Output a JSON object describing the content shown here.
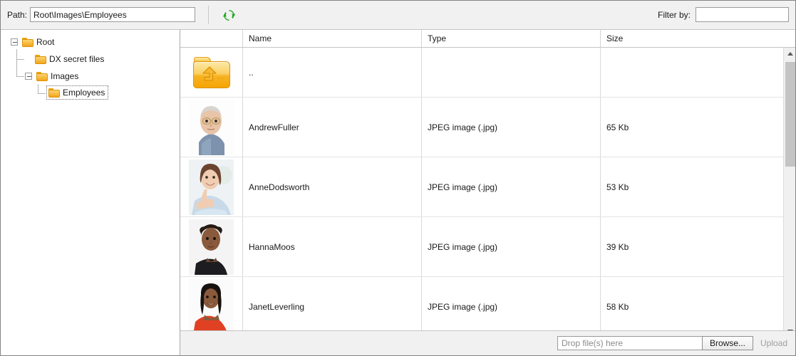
{
  "toolbar": {
    "path_label": "Path:",
    "path_value": "Root\\Images\\Employees",
    "refresh_icon": "refresh-icon",
    "filter_label": "Filter by:",
    "filter_value": "",
    "filter_placeholder": ""
  },
  "tree": {
    "nodes": [
      {
        "label": "Root",
        "icon": "folder-icon",
        "depth": 0,
        "expanded": true,
        "selected": false
      },
      {
        "label": "DX secret files",
        "icon": "folder-icon",
        "depth": 1,
        "expanded": null,
        "selected": false
      },
      {
        "label": "Images",
        "icon": "folder-icon",
        "depth": 1,
        "expanded": true,
        "selected": false
      },
      {
        "label": "Employees",
        "icon": "folder-icon",
        "depth": 2,
        "expanded": null,
        "selected": true
      }
    ]
  },
  "grid": {
    "columns": [
      {
        "key": "thumb",
        "label": ""
      },
      {
        "key": "name",
        "label": "Name"
      },
      {
        "key": "type",
        "label": "Type"
      },
      {
        "key": "size",
        "label": "Size"
      }
    ],
    "rows": [
      {
        "name": "..",
        "type": "",
        "size": "",
        "icon": "up-folder-icon"
      },
      {
        "name": "AndrewFuller",
        "type": "JPEG image (.jpg)",
        "size": "65 Kb",
        "icon": "photo-thumbnail"
      },
      {
        "name": "AnneDodsworth",
        "type": "JPEG image (.jpg)",
        "size": "53 Kb",
        "icon": "photo-thumbnail"
      },
      {
        "name": "HannaMoos",
        "type": "JPEG image (.jpg)",
        "size": "39 Kb",
        "icon": "photo-thumbnail"
      },
      {
        "name": "JanetLeverling",
        "type": "JPEG image (.jpg)",
        "size": "58 Kb",
        "icon": "photo-thumbnail"
      }
    ]
  },
  "scrollbar": {
    "up_icon": "scroll-up-arrow-icon",
    "down_icon": "scroll-down-arrow-icon"
  },
  "upload": {
    "drop_placeholder": "Drop file(s) here",
    "drop_value": "",
    "browse_label": "Browse...",
    "upload_label": "Upload"
  },
  "colors": {
    "folder": "#f3a51a",
    "refresh": "#16a516",
    "toolbar_bg": "#f1f1f1",
    "disabled_text": "#a0a0a0"
  }
}
